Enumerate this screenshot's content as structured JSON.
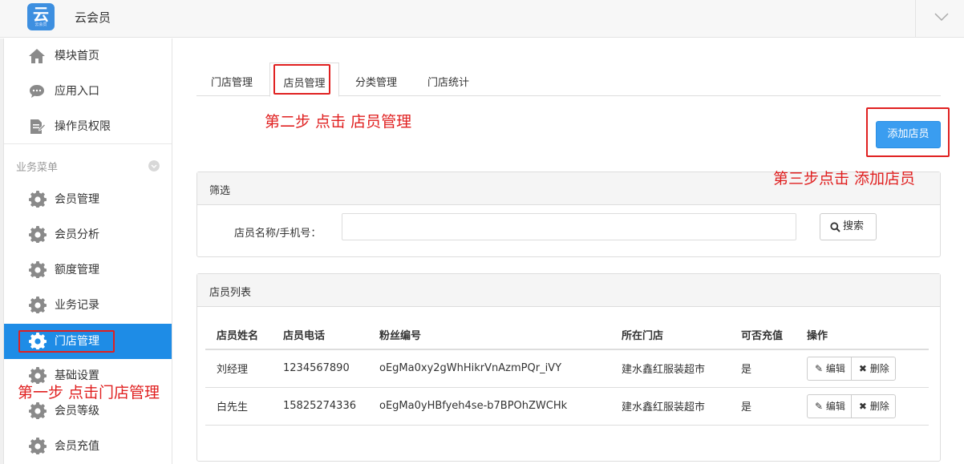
{
  "app": {
    "title": "云会员",
    "logo_glyph": "云",
    "logo_subtext": "云会员"
  },
  "sidebar": {
    "top_items": [
      {
        "label": "模块首页",
        "icon": "home-icon"
      },
      {
        "label": "应用入口",
        "icon": "chat-bubble-icon"
      },
      {
        "label": "操作员权限",
        "icon": "document-edit-icon"
      }
    ],
    "section_title": "业务菜单",
    "menu_items": [
      {
        "label": "会员管理",
        "icon": "gear-icon"
      },
      {
        "label": "会员分析",
        "icon": "gear-icon"
      },
      {
        "label": "额度管理",
        "icon": "gear-icon"
      },
      {
        "label": "业务记录",
        "icon": "gear-icon"
      },
      {
        "label": "门店管理",
        "icon": "gear-icon",
        "active": true
      },
      {
        "label": "基础设置",
        "icon": "gear-icon"
      },
      {
        "label": "会员等级",
        "icon": "gear-icon"
      },
      {
        "label": "会员充值",
        "icon": "gear-icon"
      }
    ]
  },
  "tabs": [
    {
      "label": "门店管理"
    },
    {
      "label": "店员管理",
      "active": true
    },
    {
      "label": "分类管理"
    },
    {
      "label": "门店统计"
    }
  ],
  "toolbar": {
    "add_label": "添加店员"
  },
  "filter": {
    "title": "筛选",
    "label": "店员名称/手机号：",
    "value": "",
    "search_label": "搜索"
  },
  "list": {
    "title": "店员列表",
    "columns": [
      "店员姓名",
      "店员电话",
      "粉丝编号",
      "所在门店",
      "可否充值",
      "操作"
    ],
    "rows": [
      {
        "name": "刘经理",
        "phone": "1234567890",
        "fan_id": "oEgMa0xy2gWhHikrVnAzmPQr_iVY",
        "store": "建水鑫红服装超市",
        "rechargeable": "是"
      },
      {
        "name": "白先生",
        "phone": "15825274336",
        "fan_id": "oEgMa0yHBfyeh4se-b7BPOhZWCHk",
        "store": "建水鑫红服装超市",
        "rechargeable": "是"
      }
    ],
    "edit_label": "编辑",
    "delete_label": "删除"
  },
  "annotations": {
    "step1": "第一步 点击门店管理",
    "step2": "第二步 点击 店员管理",
    "step3": "第三步点击 添加店员"
  },
  "colors": {
    "accent": "#1e8ce6",
    "button": "#3a9df0",
    "annotation": "#e02020"
  }
}
